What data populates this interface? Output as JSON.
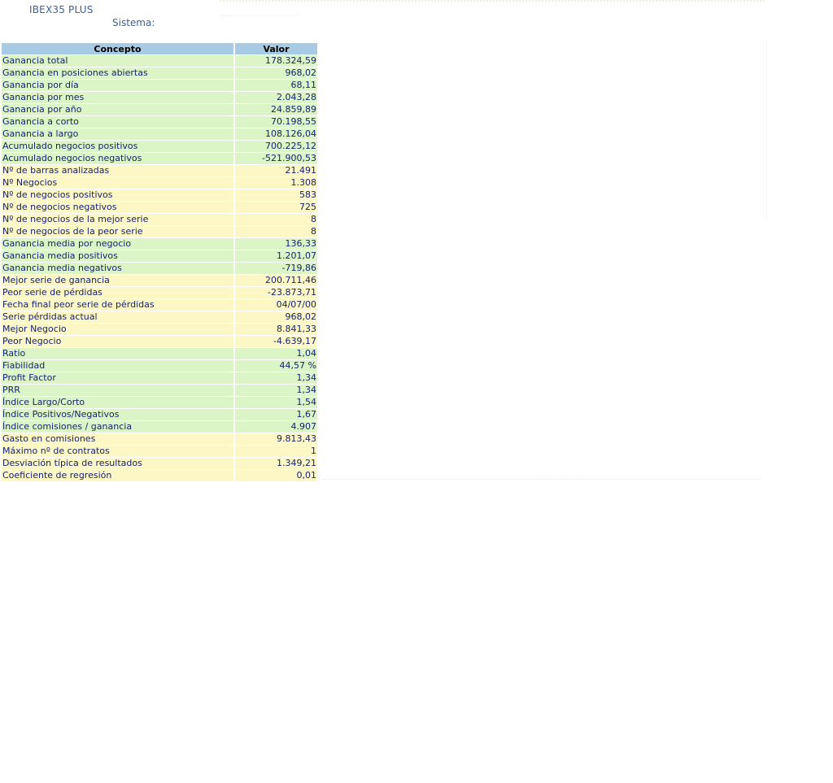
{
  "header": {
    "title": "IBEX35 PLUS",
    "system_label": "Sistema:"
  },
  "colors": {
    "header_bg": "#a8cbe5",
    "row_green": "#dcf5c6",
    "row_yellow": "#fdf7c6",
    "text": "#16236e",
    "title_text": "#3a5f9a"
  },
  "table": {
    "columns": [
      "Concepto",
      "Valor"
    ],
    "rows": [
      {
        "label": "Ganancia total",
        "value": "178.324,59",
        "color": "green"
      },
      {
        "label": "Ganancia en posiciones abiertas",
        "value": "968,02",
        "color": "green"
      },
      {
        "label": "Ganancia por día",
        "value": "68,11",
        "color": "green"
      },
      {
        "label": "Ganancia por mes",
        "value": "2.043,28",
        "color": "green"
      },
      {
        "label": "Ganancia por año",
        "value": "24.859,89",
        "color": "green"
      },
      {
        "label": "Ganancia a corto",
        "value": "70.198,55",
        "color": "green"
      },
      {
        "label": "Ganancia a largo",
        "value": "108.126,04",
        "color": "green"
      },
      {
        "label": "Acumulado negocios positivos",
        "value": "700.225,12",
        "color": "green"
      },
      {
        "label": "Acumulado negocios negativos",
        "value": "-521.900,53",
        "color": "green"
      },
      {
        "label": "Nº de barras analizadas",
        "value": "21.491",
        "color": "yellow"
      },
      {
        "label": "Nº Negocios",
        "value": "1.308",
        "color": "yellow"
      },
      {
        "label": "Nº de negocios positivos",
        "value": "583",
        "color": "yellow"
      },
      {
        "label": "Nº de negocios negativos",
        "value": "725",
        "color": "yellow"
      },
      {
        "label": "Nº de negocios de la mejor serie",
        "value": "8",
        "color": "yellow"
      },
      {
        "label": "Nº de negocios de la peor serie",
        "value": "8",
        "color": "yellow"
      },
      {
        "label": "Ganancia media por negocio",
        "value": "136,33",
        "color": "green"
      },
      {
        "label": "Ganancia media positivos",
        "value": "1.201,07",
        "color": "green"
      },
      {
        "label": "Ganancia media negativos",
        "value": "-719,86",
        "color": "green"
      },
      {
        "label": "Mejor serie de ganancia",
        "value": "200.711,46",
        "color": "yellow"
      },
      {
        "label": "Peor serie de pérdidas",
        "value": "-23.873,71",
        "color": "yellow"
      },
      {
        "label": "Fecha final peor serie de pérdidas",
        "value": "04/07/00",
        "color": "yellow"
      },
      {
        "label": "Serie pérdidas actual",
        "value": "968,02",
        "color": "yellow"
      },
      {
        "label": "Mejor Negocio",
        "value": "8.841,33",
        "color": "yellow"
      },
      {
        "label": "Peor Negocio",
        "value": "-4.639,17",
        "color": "yellow"
      },
      {
        "label": "Ratio",
        "value": "1,04",
        "color": "green"
      },
      {
        "label": "Fiabilidad",
        "value": "44,57 %",
        "color": "green"
      },
      {
        "label": "Profit Factor",
        "value": "1,34",
        "color": "green"
      },
      {
        "label": "PRR",
        "value": "1,34",
        "color": "green"
      },
      {
        "label": "Índice Largo/Corto",
        "value": "1,54",
        "color": "green"
      },
      {
        "label": "Índice Positivos/Negativos",
        "value": "1,67",
        "color": "green"
      },
      {
        "label": "Índice comisiones / ganancia",
        "value": "4.907",
        "color": "green"
      },
      {
        "label": "Gasto en comisiones",
        "value": "9.813,43",
        "color": "yellow"
      },
      {
        "label": "Máximo nº de contratos",
        "value": "1",
        "color": "yellow"
      },
      {
        "label": "Desviación típica de resultados",
        "value": "1.349,21",
        "color": "yellow"
      },
      {
        "label": "Coeficiente de regresión",
        "value": "0,01",
        "color": "yellow"
      }
    ]
  }
}
